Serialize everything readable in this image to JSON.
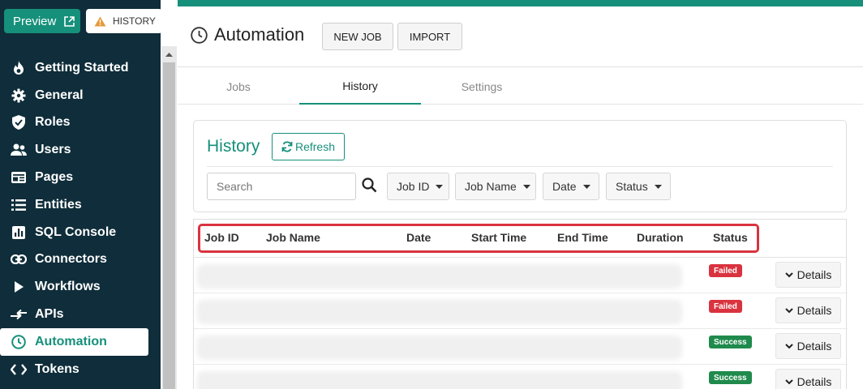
{
  "colors": {
    "brand": "#16907b",
    "sidebar_bg": "#0f2d3a",
    "failed": "#d9333f",
    "success": "#1f8a4c",
    "highlight_border": "#d9333f"
  },
  "top_buttons": {
    "preview_label": "Preview",
    "history_label": "HISTORY"
  },
  "sidebar": {
    "items": [
      {
        "label": "Getting Started",
        "icon": "flame-icon"
      },
      {
        "label": "General",
        "icon": "gear-icon"
      },
      {
        "label": "Roles",
        "icon": "shield-check-icon"
      },
      {
        "label": "Users",
        "icon": "users-icon"
      },
      {
        "label": "Pages",
        "icon": "page-icon"
      },
      {
        "label": "Entities",
        "icon": "list-icon"
      },
      {
        "label": "SQL Console",
        "icon": "chart-icon"
      },
      {
        "label": "Connectors",
        "icon": "link-icon"
      },
      {
        "label": "Workflows",
        "icon": "play-icon"
      },
      {
        "label": "APIs",
        "icon": "api-arrows-icon"
      },
      {
        "label": "Automation",
        "icon": "clock-icon",
        "active": true
      },
      {
        "label": "Tokens",
        "icon": "code-icon"
      }
    ]
  },
  "header": {
    "title": "Automation",
    "new_job_label": "NEW JOB",
    "import_label": "IMPORT"
  },
  "tabs": [
    {
      "label": "Jobs"
    },
    {
      "label": "History",
      "active": true
    },
    {
      "label": "Settings"
    }
  ],
  "history": {
    "title": "History",
    "refresh_label": "Refresh",
    "search_placeholder": "Search",
    "filters": [
      {
        "label": "Job ID"
      },
      {
        "label": "Job Name"
      },
      {
        "label": "Date"
      },
      {
        "label": "Status"
      }
    ],
    "columns": [
      "Job ID",
      "Job Name",
      "Date",
      "Start Time",
      "End Time",
      "Duration",
      "Status"
    ],
    "rows": [
      {
        "status": "Failed",
        "details_label": "Details"
      },
      {
        "status": "Failed",
        "details_label": "Details"
      },
      {
        "status": "Success",
        "details_label": "Details"
      },
      {
        "status": "Success",
        "details_label": "Details"
      }
    ]
  }
}
